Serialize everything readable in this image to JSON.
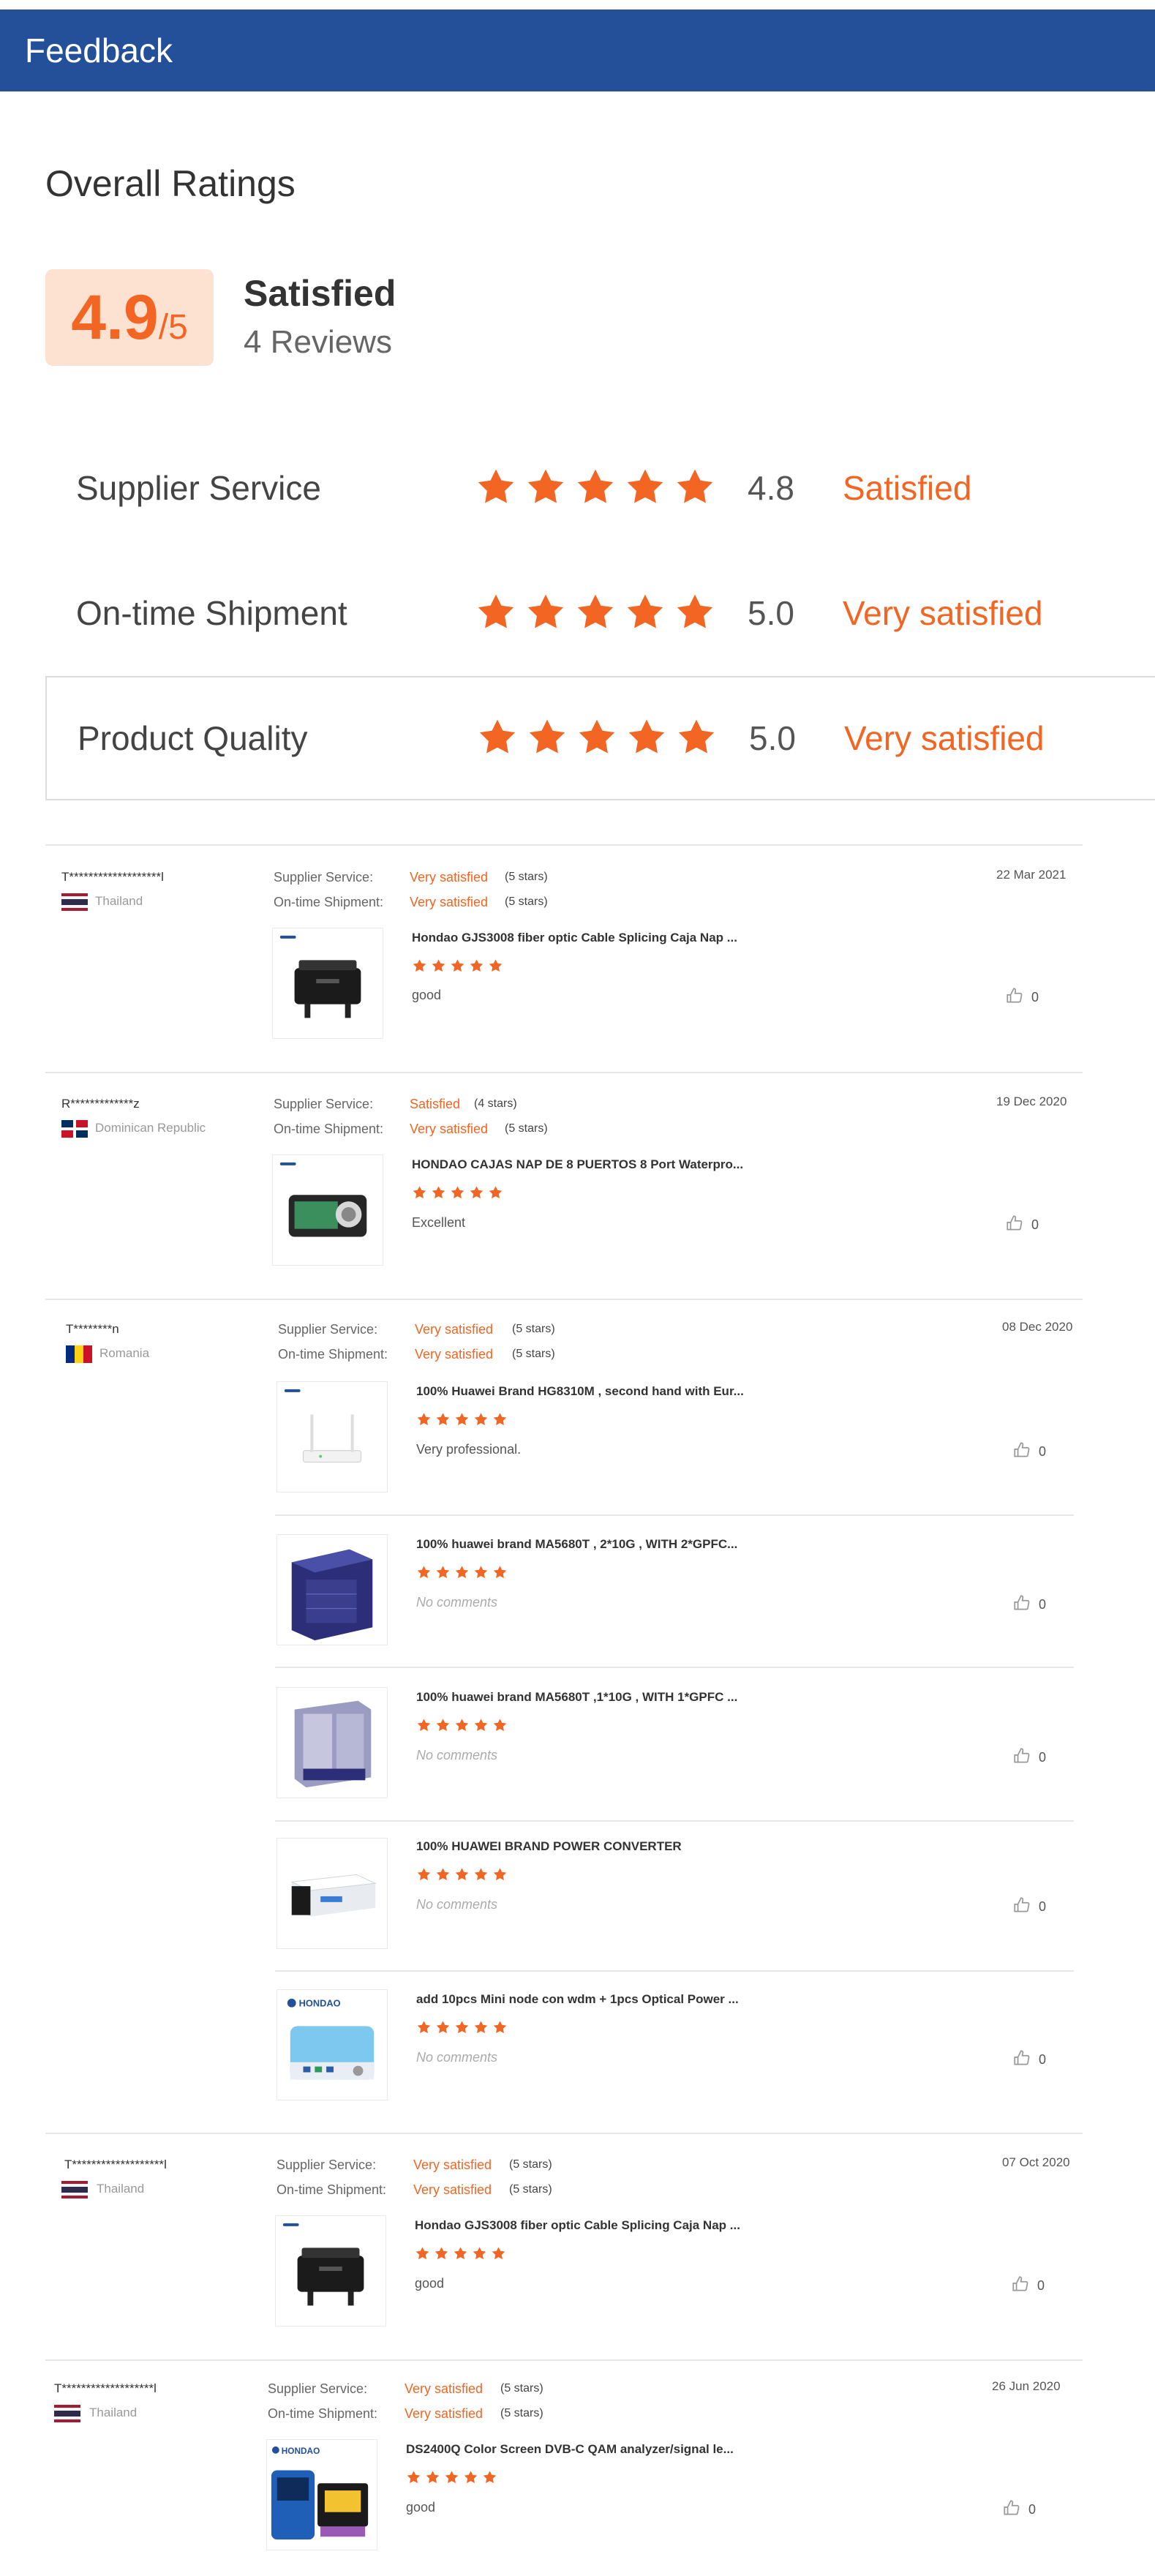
{
  "header": {
    "title": "Feedback"
  },
  "overall": {
    "title": "Overall Ratings",
    "score": "4.9",
    "out_of": "/5",
    "sentiment": "Satisfied",
    "reviews": "4 Reviews"
  },
  "metrics": [
    {
      "label": "Supplier Service",
      "value": "4.8",
      "text": "Satisfied",
      "rating": 4.8
    },
    {
      "label": "On-time Shipment",
      "value": "5.0",
      "text": "Very satisfied",
      "rating": 5.0
    },
    {
      "label": "Product Quality",
      "value": "5.0",
      "text": "Very satisfied",
      "rating": 5.0
    }
  ],
  "labels": {
    "supplier": "Supplier Service:",
    "shipment": "On-time Shipment:"
  },
  "colors": {
    "brand": "#24509a",
    "accent": "#f26522",
    "score_bg": "#fde2d2"
  },
  "reviews": [
    {
      "user": "T*******************l",
      "country": "Thailand",
      "flag": "flag-thailand-icon",
      "supplier": "Very satisfied",
      "supplier_stars": "(5 stars)",
      "shipment": "Very satisfied",
      "shipment_stars": "(5 stars)",
      "date": "22 Mar 2021",
      "items": [
        {
          "title": "Hondao GJS3008 fiber optic Cable Splicing Caja Nap ...",
          "comment": "good",
          "likes": "0",
          "rating": 5,
          "icon": "splice-closure-icon"
        }
      ]
    },
    {
      "user": "R*************z",
      "country": "Dominican Republic",
      "flag": "flag-dominican-republic-icon",
      "supplier": "Satisfied",
      "supplier_stars": "(4 stars)",
      "shipment": "Very satisfied",
      "shipment_stars": "(5 stars)",
      "date": "19 Dec 2020",
      "items": [
        {
          "title": "HONDAO CAJAS NAP DE 8 PUERTOS 8 Port Waterpro...",
          "comment": "Excellent",
          "likes": "0",
          "rating": 5,
          "icon": "nap-box-icon"
        }
      ]
    },
    {
      "user": "T********n",
      "country": "Romania",
      "flag": "flag-romania-icon",
      "supplier": "Very satisfied",
      "supplier_stars": "(5 stars)",
      "shipment": "Very satisfied",
      "shipment_stars": "(5 stars)",
      "date": "08 Dec 2020",
      "items": [
        {
          "title": "100% Huawei Brand HG8310M , second hand with Eur...",
          "comment": "Very professional.",
          "likes": "0",
          "rating": 5,
          "icon": "router-icon"
        },
        {
          "title": "100% huawei brand MA5680T , 2*10G , WITH 2*GPFC...",
          "comment": "No comments",
          "likes": "0",
          "rating": 5,
          "icon": "olt-chassis-icon"
        },
        {
          "title": "100% huawei brand MA5680T ,1*10G , WITH 1*GPFC ...",
          "comment": "No comments",
          "likes": "0",
          "rating": 5,
          "icon": "olt-chassis-open-icon"
        },
        {
          "title": "100% HUAWEI BRAND POWER CONVERTER",
          "comment": "No comments",
          "likes": "0",
          "rating": 5,
          "icon": "power-converter-icon"
        },
        {
          "title": "add 10pcs Mini node con wdm + 1pcs Optical Power ...",
          "comment": "No comments",
          "likes": "0",
          "rating": 5,
          "icon": "mini-node-icon",
          "brand": "HONDAO"
        }
      ]
    },
    {
      "user": "T*******************l",
      "country": "Thailand",
      "flag": "flag-thailand-icon",
      "supplier": "Very satisfied",
      "supplier_stars": "(5 stars)",
      "shipment": "Very satisfied",
      "shipment_stars": "(5 stars)",
      "date": "07 Oct 2020",
      "items": [
        {
          "title": "Hondao GJS3008 fiber optic Cable Splicing Caja Nap ...",
          "comment": "good",
          "likes": "0",
          "rating": 5,
          "icon": "splice-closure-icon"
        }
      ]
    },
    {
      "user": "T*******************l",
      "country": "Thailand",
      "flag": "flag-thailand-icon",
      "supplier": "Very satisfied",
      "supplier_stars": "(5 stars)",
      "shipment": "Very satisfied",
      "shipment_stars": "(5 stars)",
      "date": "26 Jun 2020",
      "items": [
        {
          "title": "DS2400Q Color Screen DVB-C QAM analyzer/signal le...",
          "comment": "good",
          "likes": "0",
          "rating": 5,
          "icon": "signal-analyzer-icon",
          "brand": "HONDAO"
        }
      ]
    }
  ]
}
